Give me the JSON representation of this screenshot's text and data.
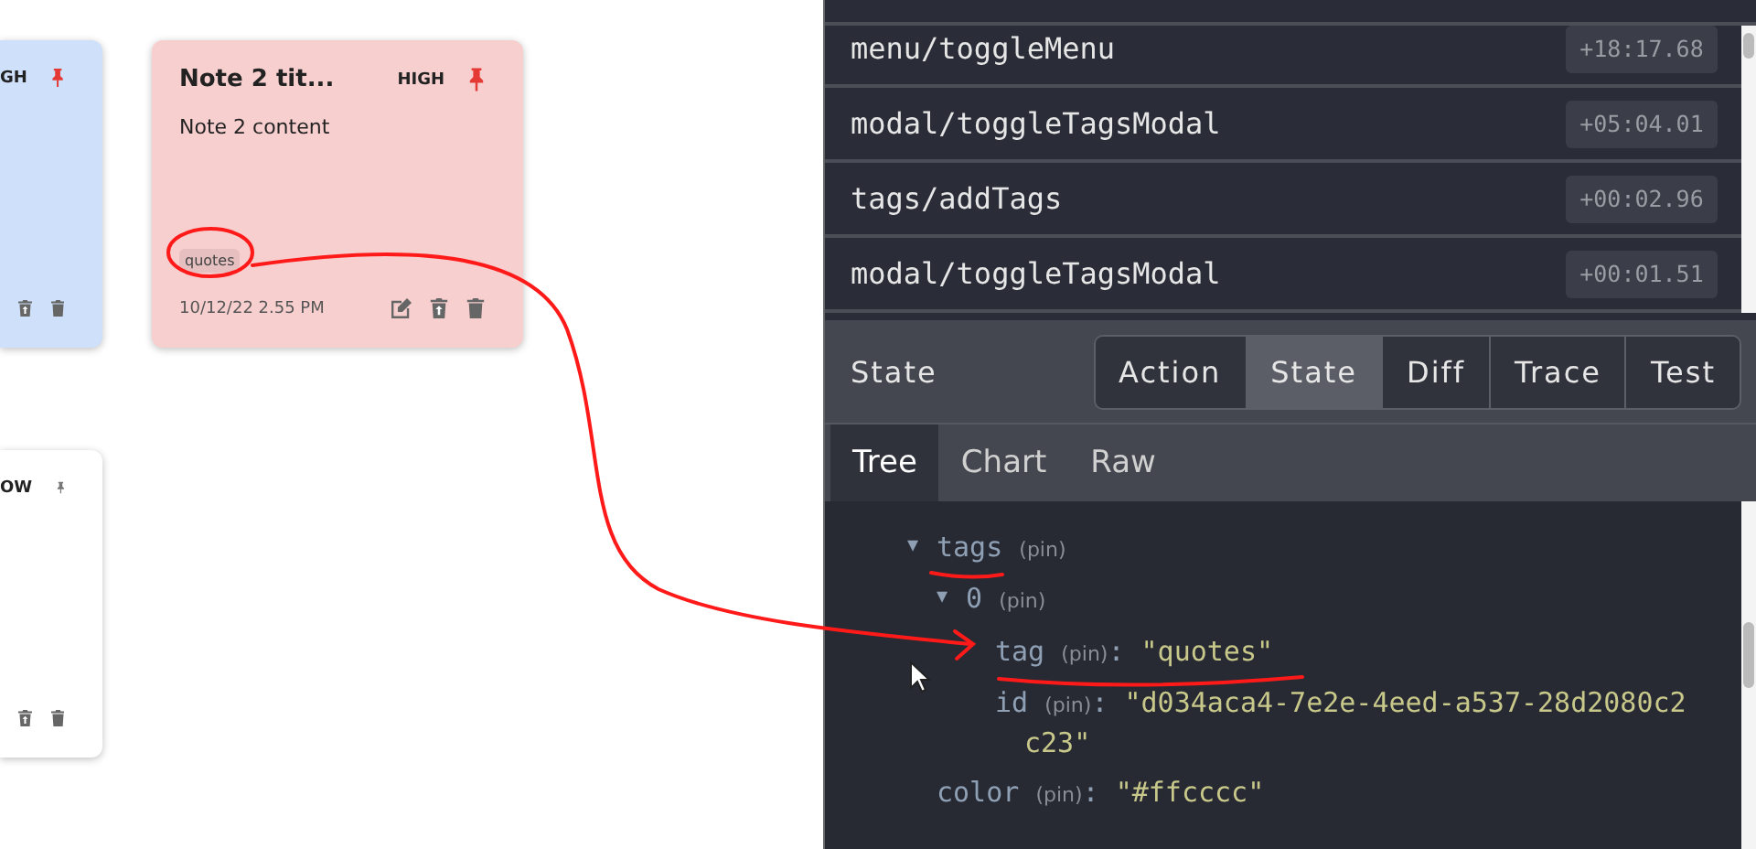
{
  "notes": [
    {
      "color": "#cfe0fb",
      "priority": "GH",
      "pinned": true,
      "actions": [
        {
          "kind": "restore"
        },
        {
          "kind": "delete"
        }
      ]
    },
    {
      "color": "#f8cfcf",
      "title": "Note 2 tit...",
      "priority": "HIGH",
      "pinned": true,
      "content": "Note 2 content",
      "tags": [
        "quotes"
      ],
      "date": "10/12/22 2.55 PM",
      "actions": [
        {
          "kind": "edit"
        },
        {
          "kind": "restore"
        },
        {
          "kind": "delete"
        }
      ]
    },
    {
      "color": "#ffffff",
      "priority": "OW",
      "pinned": false,
      "actions": [
        {
          "kind": "restore"
        },
        {
          "kind": "delete"
        }
      ]
    }
  ],
  "devtools": {
    "actions": [
      {
        "name": "menu/toggleMenu",
        "time": "+18:17.68"
      },
      {
        "name": "modal/toggleTagsModal",
        "time": "+05:04.01"
      },
      {
        "name": "tags/addTags",
        "time": "+00:02.96"
      },
      {
        "name": "modal/toggleTagsModal",
        "time": "+00:01.51"
      }
    ],
    "panel_title": "State",
    "tabs": [
      {
        "label": "Action",
        "selected": false
      },
      {
        "label": "State",
        "selected": true
      },
      {
        "label": "Diff",
        "selected": false
      },
      {
        "label": "Trace",
        "selected": false
      },
      {
        "label": "Test",
        "selected": false
      }
    ],
    "view_tabs": [
      {
        "label": "Tree",
        "selected": true
      },
      {
        "label": "Chart",
        "selected": false
      },
      {
        "label": "Raw",
        "selected": false
      }
    ],
    "tree": [
      {
        "toggle": "▼",
        "key": "tags",
        "pin": "(pin)",
        "children": [
          {
            "toggle": "▼",
            "key": "0",
            "pin": "(pin)",
            "children": [
              {
                "key": "tag",
                "pin": "(pin)",
                "separator": ":",
                "value": "\"quotes\""
              },
              {
                "key": "id",
                "pin": "(pin)",
                "separator": ":",
                "value": "\"d034aca4-7e2e-4eed-a537-28d2080c2c23\""
              }
            ]
          }
        ]
      },
      {
        "key": "color",
        "pin": "(pin)",
        "separator": ":",
        "value": "\"#ffcccc\""
      }
    ]
  }
}
